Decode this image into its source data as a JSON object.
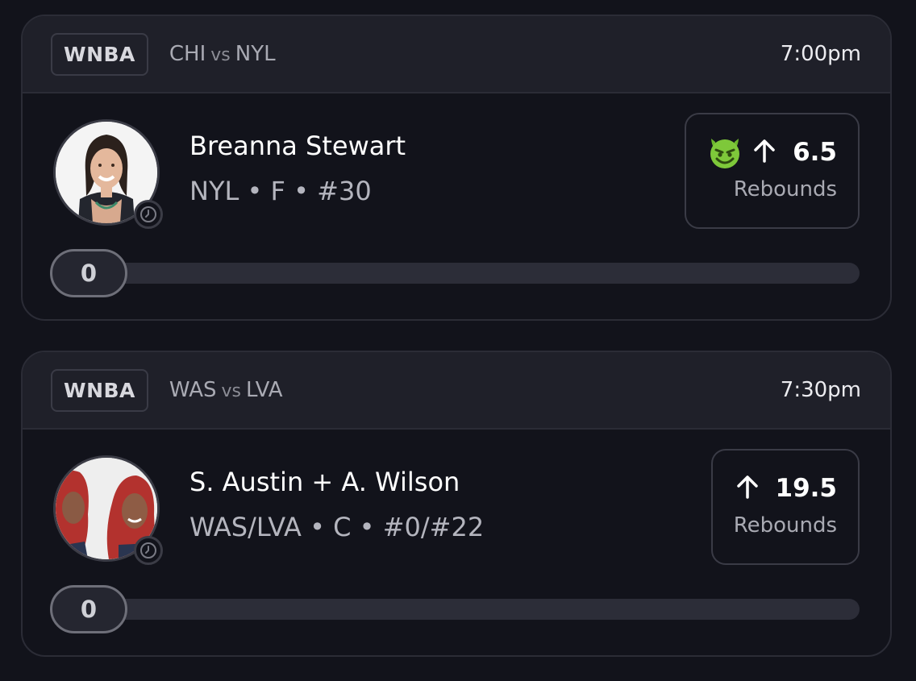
{
  "cards": [
    {
      "league": "WNBA",
      "away_team": "CHI",
      "vs": "vs",
      "home_team": "NYL",
      "time": "7:00pm",
      "player_name": "Breanna Stewart",
      "player_meta": "NYL • F • #30",
      "pick_icon": "devil-emoji-icon",
      "direction": "up-arrow-icon",
      "line": "6.5",
      "stat": "Rebounds",
      "current": "0"
    },
    {
      "league": "WNBA",
      "away_team": "WAS",
      "vs": "vs",
      "home_team": "LVA",
      "time": "7:30pm",
      "player_name": "S. Austin + A. Wilson",
      "player_meta": "WAS/LVA • C • #0/#22",
      "direction": "up-arrow-icon",
      "line": "19.5",
      "stat": "Rebounds",
      "current": "0"
    }
  ],
  "colors": {
    "background": "#12131b",
    "card_header": "#1f2029",
    "border": "#2b2c36",
    "track": "#2c2d38",
    "devil_green": "#7ec83a"
  }
}
